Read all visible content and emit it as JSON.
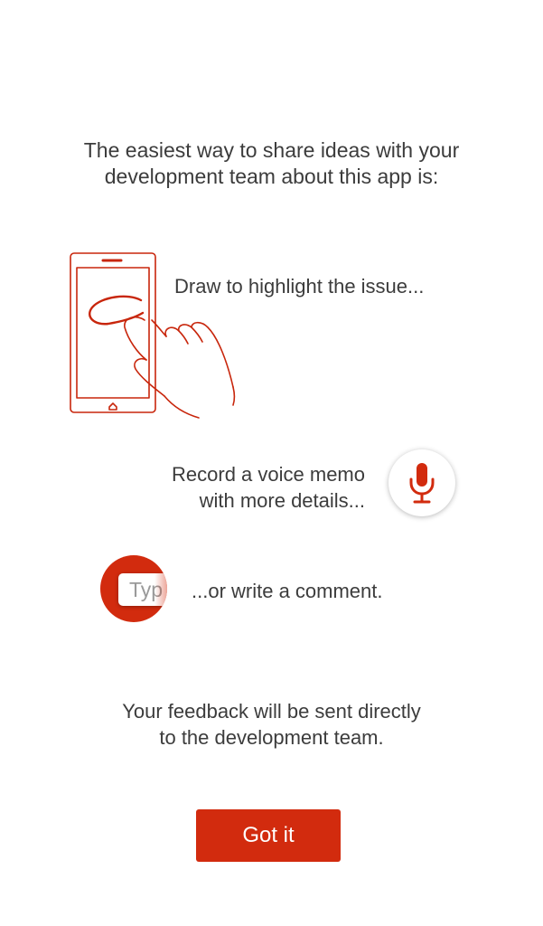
{
  "intro": {
    "line1": "The easiest way to share ideas with your",
    "line2": "development team about this app is:"
  },
  "steps": {
    "draw": {
      "label": "Draw to highlight the issue...",
      "icon": "phone-drawing-hand-icon"
    },
    "voice": {
      "line1": "Record a voice memo",
      "line2": "with more details...",
      "icon": "microphone-icon"
    },
    "comment": {
      "label": "...or write a comment.",
      "field_text": "Typ",
      "icon": "comment-field-icon"
    }
  },
  "outro": {
    "line1": "Your feedback will be sent directly",
    "line2": "to the development team."
  },
  "actions": {
    "got_it_label": "Got it"
  },
  "colors": {
    "accent": "#d22b0e",
    "text": "#3c3c3c",
    "background": "#ffffff"
  }
}
